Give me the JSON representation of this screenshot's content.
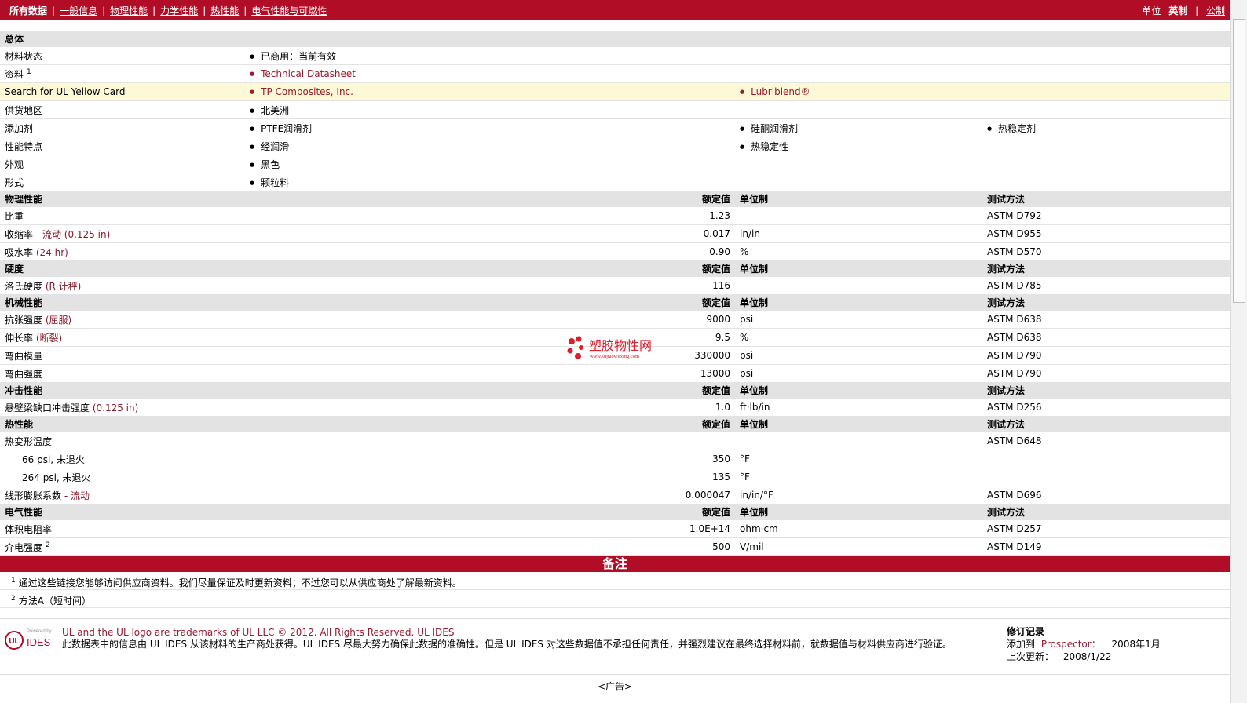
{
  "nav": {
    "items": [
      "所有数据",
      "一般信息",
      "物理性能",
      "力学性能",
      "热性能",
      "电气性能与可燃性"
    ],
    "units_label": "单位",
    "unit_imperial": "英制",
    "unit_metric": "公制"
  },
  "general": {
    "header": "总体",
    "rows": [
      {
        "label": "材料状态",
        "values": [
          "已商用：当前有效"
        ]
      },
      {
        "label": "资料",
        "sup": "1",
        "values": [
          "Technical Datasheet"
        ],
        "link": true
      },
      {
        "label": "Search for UL Yellow Card",
        "values": [
          "TP Composites, Inc.",
          "Lubriblend®"
        ],
        "link": true
      },
      {
        "label": "供货地区",
        "values": [
          "北美洲"
        ]
      },
      {
        "label": "添加剂",
        "values": [
          "PTFE润滑剂",
          "硅酮润滑剂",
          "热稳定剂"
        ]
      },
      {
        "label": "性能特点",
        "values": [
          "经润滑",
          "热稳定性"
        ]
      },
      {
        "label": "外观",
        "values": [
          "黑色"
        ]
      },
      {
        "label": "形式",
        "values": [
          "颗粒料"
        ]
      }
    ]
  },
  "col_headers": {
    "value": "额定值",
    "unit": "单位制",
    "method": "测试方法"
  },
  "sections": [
    {
      "title": "物理性能",
      "rows": [
        {
          "label": "比重",
          "cond": "",
          "value": "1.23",
          "unit": "",
          "method": "ASTM D792"
        },
        {
          "label": "收缩率",
          "cond": " - 流动 (0.125 in)",
          "value": "0.017",
          "unit": "in/in",
          "method": "ASTM D955"
        },
        {
          "label": "吸水率",
          "cond": " (24 hr)",
          "value": "0.90",
          "unit": "%",
          "method": "ASTM D570"
        }
      ]
    },
    {
      "title": "硬度",
      "rows": [
        {
          "label": "洛氏硬度",
          "cond": " (R 计秤)",
          "value": "116",
          "unit": "",
          "method": "ASTM D785"
        }
      ]
    },
    {
      "title": "机械性能",
      "rows": [
        {
          "label": "抗张强度",
          "cond": " (屈服)",
          "value": "9000",
          "unit": "psi",
          "method": "ASTM D638"
        },
        {
          "label": "伸长率",
          "cond": " (断裂)",
          "value": "9.5",
          "unit": "%",
          "method": "ASTM D638"
        },
        {
          "label": "弯曲模量",
          "cond": "",
          "value": "330000",
          "unit": "psi",
          "method": "ASTM D790"
        },
        {
          "label": "弯曲强度",
          "cond": "",
          "value": "13000",
          "unit": "psi",
          "method": "ASTM D790"
        }
      ]
    },
    {
      "title": "冲击性能",
      "rows": [
        {
          "label": "悬壁梁缺口冲击强度",
          "cond": " (0.125 in)",
          "value": "1.0",
          "unit": "ft·lb/in",
          "method": "ASTM D256"
        }
      ]
    },
    {
      "title": "热性能",
      "rows": [
        {
          "label": "热变形温度",
          "cond": "",
          "value": "",
          "unit": "",
          "method": "ASTM D648"
        },
        {
          "label": "66 psi, 未退火",
          "cond": "",
          "value": "350",
          "unit": "°F",
          "method": "",
          "sub": true
        },
        {
          "label": "264 psi, 未退火",
          "cond": "",
          "value": "135",
          "unit": "°F",
          "method": "",
          "sub": true
        },
        {
          "label": "线形膨胀系数",
          "cond": " - 流动",
          "value": "0.000047",
          "unit": "in/in/°F",
          "method": "ASTM D696"
        }
      ]
    },
    {
      "title": "电气性能",
      "rows": [
        {
          "label": "体积电阻率",
          "cond": "",
          "value": "1.0E+14",
          "unit": "ohm·cm",
          "method": "ASTM D257"
        },
        {
          "label": "介电强度",
          "sup": "2",
          "cond": "",
          "value": "500",
          "unit": "V/mil",
          "method": "ASTM D149"
        }
      ]
    }
  ],
  "notes": {
    "title": "备注",
    "items": [
      {
        "n": "1",
        "text": "通过这些链接您能够访问供应商资料。我们尽量保证及时更新资料；不过您可以从供应商处了解最新资料。"
      },
      {
        "n": "2",
        "text": "方法A（短时间）"
      }
    ]
  },
  "footer": {
    "logo_small": "Powered by",
    "logo_text": "IDES",
    "line1": "UL and the UL logo are trademarks of UL LLC © 2012. All Rights Reserved.",
    "line1_link": "UL IDES",
    "line2": "此数据表中的信息由 UL IDES 从该材料的生产商处获得。UL IDES 尽最大努力确保此数据的准确性。但是 UL IDES 对这些数据值不承担任何责任，并强烈建议在最终选择材料前，就数据值与材料供应商进行验证。",
    "rev_title": "修订记录",
    "added_label": "添加到",
    "added_link": "Prospector：",
    "added_date": "2008年1月",
    "updated_label": "上次更新：",
    "updated_date": "2008/1/22"
  },
  "ad": "<广告>",
  "watermark": {
    "cn": "塑胶物性网",
    "url": "www.sujiaowuxing.com"
  }
}
